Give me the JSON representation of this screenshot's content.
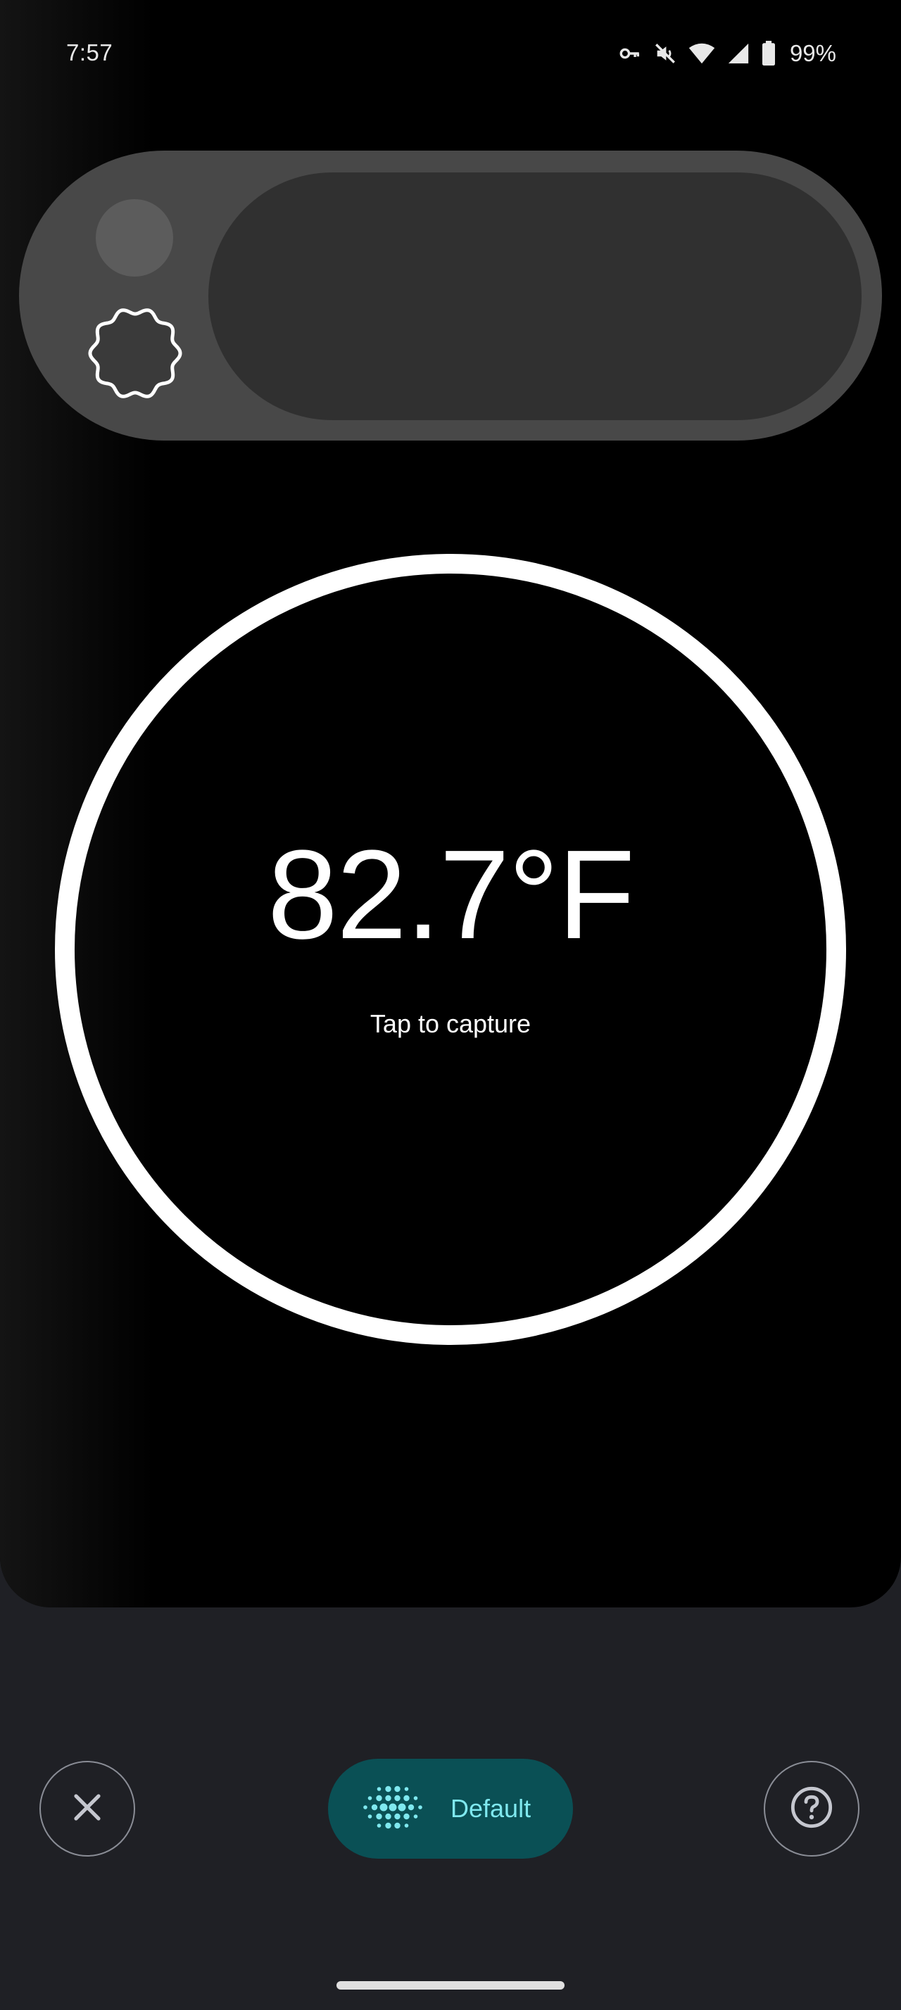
{
  "status_bar": {
    "time": "7:57",
    "battery_percent": "99%",
    "icons": [
      "vpn-key-icon",
      "mute-icon",
      "wifi-icon",
      "cell-signal-icon",
      "battery-icon"
    ]
  },
  "thermometer": {
    "temperature": "82.7°F",
    "hint": "Tap to capture"
  },
  "bottom_bar": {
    "close_icon": "close-icon",
    "mode_label": "Default",
    "mode_icon": "sensor-dots-icon",
    "help_icon": "help-icon"
  },
  "colors": {
    "accent": "#7fe8ef",
    "chip_background": "#0a5055",
    "background": "#1f2025"
  }
}
